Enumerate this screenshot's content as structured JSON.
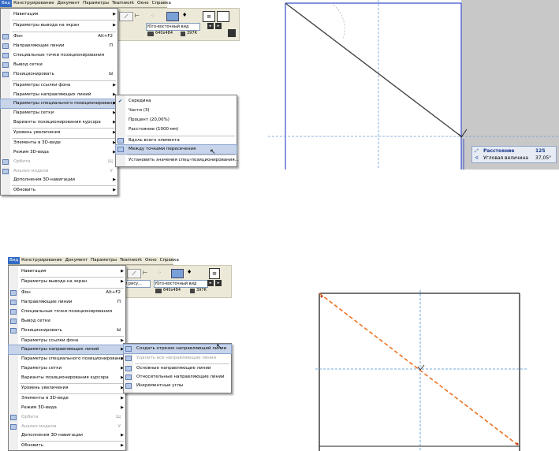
{
  "menubar": [
    "Вид",
    "Конструирование",
    "Документ",
    "Параметры",
    "Teamwork",
    "Окно",
    "Справка"
  ],
  "menu1": {
    "items": [
      {
        "label": "Навигация",
        "arrow": true
      },
      {
        "label": "Параметры вывода на экран",
        "arrow": true
      },
      {
        "label": "Фон",
        "shortcut": "Alt+F2",
        "icon": "background-icon"
      },
      {
        "label": "Направляющие линии",
        "shortcut": "П",
        "icon": "guide-lines-icon"
      },
      {
        "label": "Специальные точки позиционирования",
        "icon": "special-snap-points-icon"
      },
      {
        "label": "Вывод сетки",
        "icon": "grid-display-icon"
      },
      {
        "label": "Позиционировать",
        "shortcut": "Ы",
        "icon": "snap-icon"
      },
      {
        "label": "Параметры ссылки фона",
        "arrow": true
      },
      {
        "label": "Параметры направляющих линий",
        "arrow": true
      },
      {
        "label": "Параметры специального позиционирования",
        "arrow": true
      },
      {
        "label": "Параметры сетки",
        "arrow": true
      },
      {
        "label": "Варианты позиционирования курсора",
        "arrow": true
      },
      {
        "label": "Уровень увеличения",
        "arrow": true
      },
      {
        "label": "Элементы в 3D-виде",
        "arrow": true
      },
      {
        "label": "Режим 3D-вида",
        "arrow": true
      },
      {
        "label": "Орбита",
        "shortcut": "Щ",
        "disabled": true,
        "icon": "orbit-icon"
      },
      {
        "label": "Анализ модели",
        "shortcut": "У",
        "disabled": true,
        "icon": "model-analysis-icon"
      },
      {
        "label": "Дополнения 3D-навигации",
        "arrow": true
      },
      {
        "label": "Обновить",
        "arrow": true
      }
    ]
  },
  "submenu1": {
    "items": [
      {
        "label": "Середина",
        "checked": true
      },
      {
        "label": "Части (3)"
      },
      {
        "label": "Процент (20,00%)"
      },
      {
        "label": "Расстояние (1000 мм)"
      },
      {
        "label": "Вдоль всего элемента",
        "icon": "along-element-icon"
      },
      {
        "label": "Между точками пересечения",
        "icon": "between-intersections-icon"
      },
      {
        "label": "Установить значения спец-позиционирования..."
      }
    ]
  },
  "toolbar1": {
    "view_name": "Юго-восточный вид",
    "size": "640x484",
    "mem": "397К"
  },
  "toolbar2": {
    "view_name": "Юго-восточный вид",
    "size": "640x484",
    "mem": "397К",
    "combo": "ж и рису..."
  },
  "info_box": {
    "row1_label": "Расстояние",
    "row1_value": "125",
    "row2_label": "Угловая величина",
    "row2_value": "37,05°"
  },
  "submenu2": {
    "items": [
      {
        "label": "Создать отрезок направляющей линии",
        "icon": "create-guide-segment-icon"
      },
      {
        "label": "Удалить все направляющие линии",
        "disabled": true,
        "icon": "remove-guides-icon"
      },
      {
        "label": "Основные направляющие линии",
        "icon": "main-guides-icon"
      },
      {
        "label": "Относительные направляющие линии",
        "icon": "relative-guides-icon"
      },
      {
        "label": "Инкрементные углы",
        "icon": "incremental-angles-icon"
      }
    ]
  },
  "colors": {
    "highlight": "#c7d4ea",
    "menubar": "#ece9d8",
    "guide_orange": "#f07020",
    "guide_blue": "#4a90d0"
  }
}
